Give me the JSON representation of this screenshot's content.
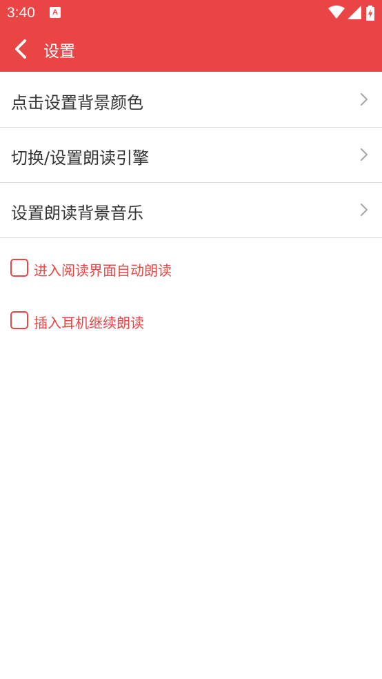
{
  "status_bar": {
    "time": "3:40",
    "notification_icon": "A",
    "icons": [
      "wifi-icon",
      "signal-icon",
      "battery-icon"
    ]
  },
  "toolbar": {
    "back_icon": "chevron-left-icon",
    "title": "设置",
    "color": "#e94545"
  },
  "menu": {
    "items": [
      {
        "label": "点击设置背景颜色",
        "icon": "chevron-right-icon"
      },
      {
        "label": "切换/设置朗读引擎",
        "icon": "chevron-right-icon"
      },
      {
        "label": "设置朗读背景音乐",
        "icon": "chevron-right-icon"
      }
    ]
  },
  "options": {
    "items": [
      {
        "label": "进入阅读界面自动朗读",
        "checked": false
      },
      {
        "label": "插入耳机继续朗读",
        "checked": false
      }
    ]
  }
}
